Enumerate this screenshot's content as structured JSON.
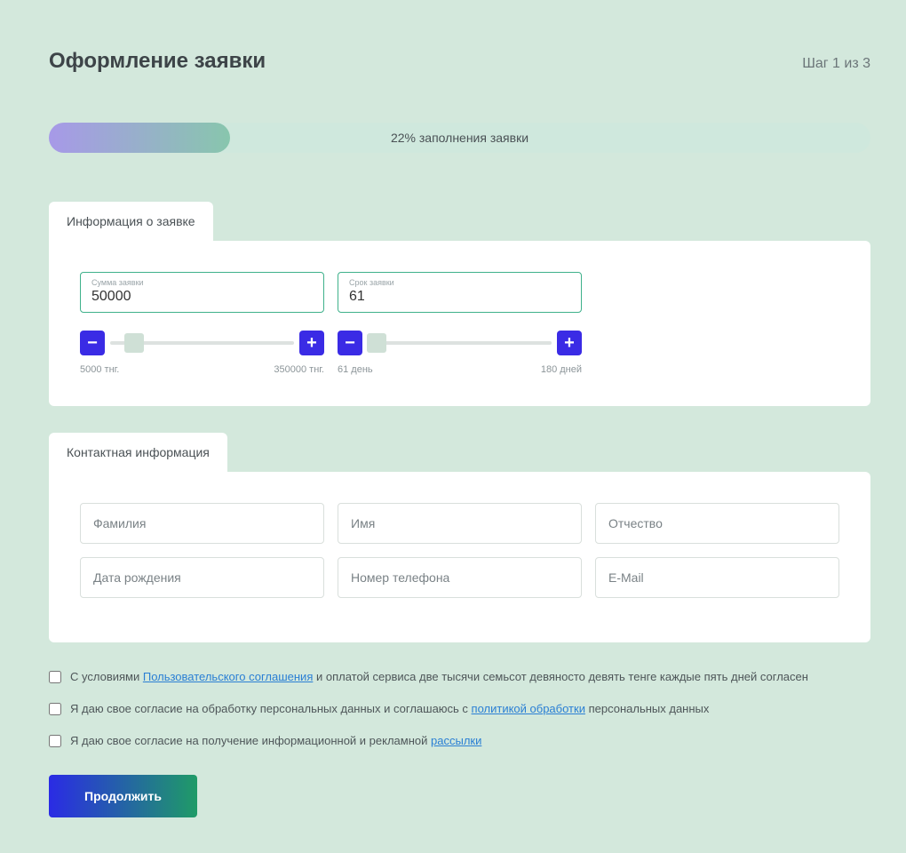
{
  "header": {
    "title": "Оформление заявки",
    "step": "Шаг 1 из 3"
  },
  "progress": {
    "percent": 22,
    "label": "22% заполнения заявки"
  },
  "section_info": {
    "tab": "Информация о заявке",
    "amount": {
      "label": "Сумма заявки",
      "value": "50000",
      "min": "5000 тнг.",
      "max": "350000 тнг.",
      "thumb_pct": 13
    },
    "term": {
      "label": "Срок заявки",
      "value": "61",
      "min": "61 день",
      "max": "180 дней",
      "thumb_pct": 5
    }
  },
  "section_contact": {
    "tab": "Контактная информация",
    "fields": {
      "lastname": "Фамилия",
      "firstname": "Имя",
      "patronymic": "Отчество",
      "dob": "Дата рождения",
      "phone": "Номер телефона",
      "email": "E-Mail"
    }
  },
  "consents": {
    "terms_pre": "С условиями ",
    "terms_link": "Пользовательского соглашения",
    "terms_post": " и оплатой сервиса две тысячи семьсот девяносто девять тенге каждые пять дней согласен",
    "data_pre": "Я даю свое согласие на обработку персональных данных и соглашаюсь с ",
    "data_link": "политикой обработки",
    "data_post": " персональных данных",
    "mail_pre": "Я даю свое согласие на получение информационной и рекламной ",
    "mail_link": "рассылки"
  },
  "cta": "Продолжить"
}
